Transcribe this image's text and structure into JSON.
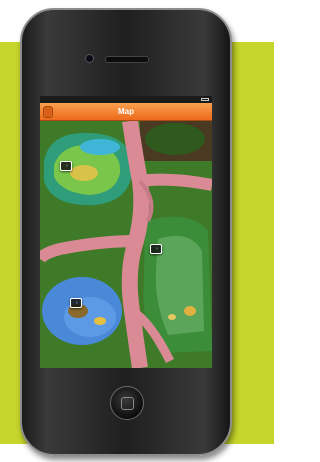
{
  "status_bar": {
    "carrier": "",
    "time": "",
    "battery_icon": "battery-icon"
  },
  "nav_bar": {
    "back_label": "",
    "title": "Map"
  },
  "map": {
    "callouts": [
      {
        "label": "",
        "icon": "chevron-right-icon"
      },
      {
        "label": "",
        "icon": "chevron-right-icon"
      },
      {
        "label": "",
        "icon": "chevron-right-icon"
      }
    ]
  },
  "colors": {
    "backdrop": "#c5d52a",
    "nav_bar": "#f08a30",
    "path": "#d98a95",
    "grass": "#3f7a28",
    "water": "#4a88d8"
  }
}
